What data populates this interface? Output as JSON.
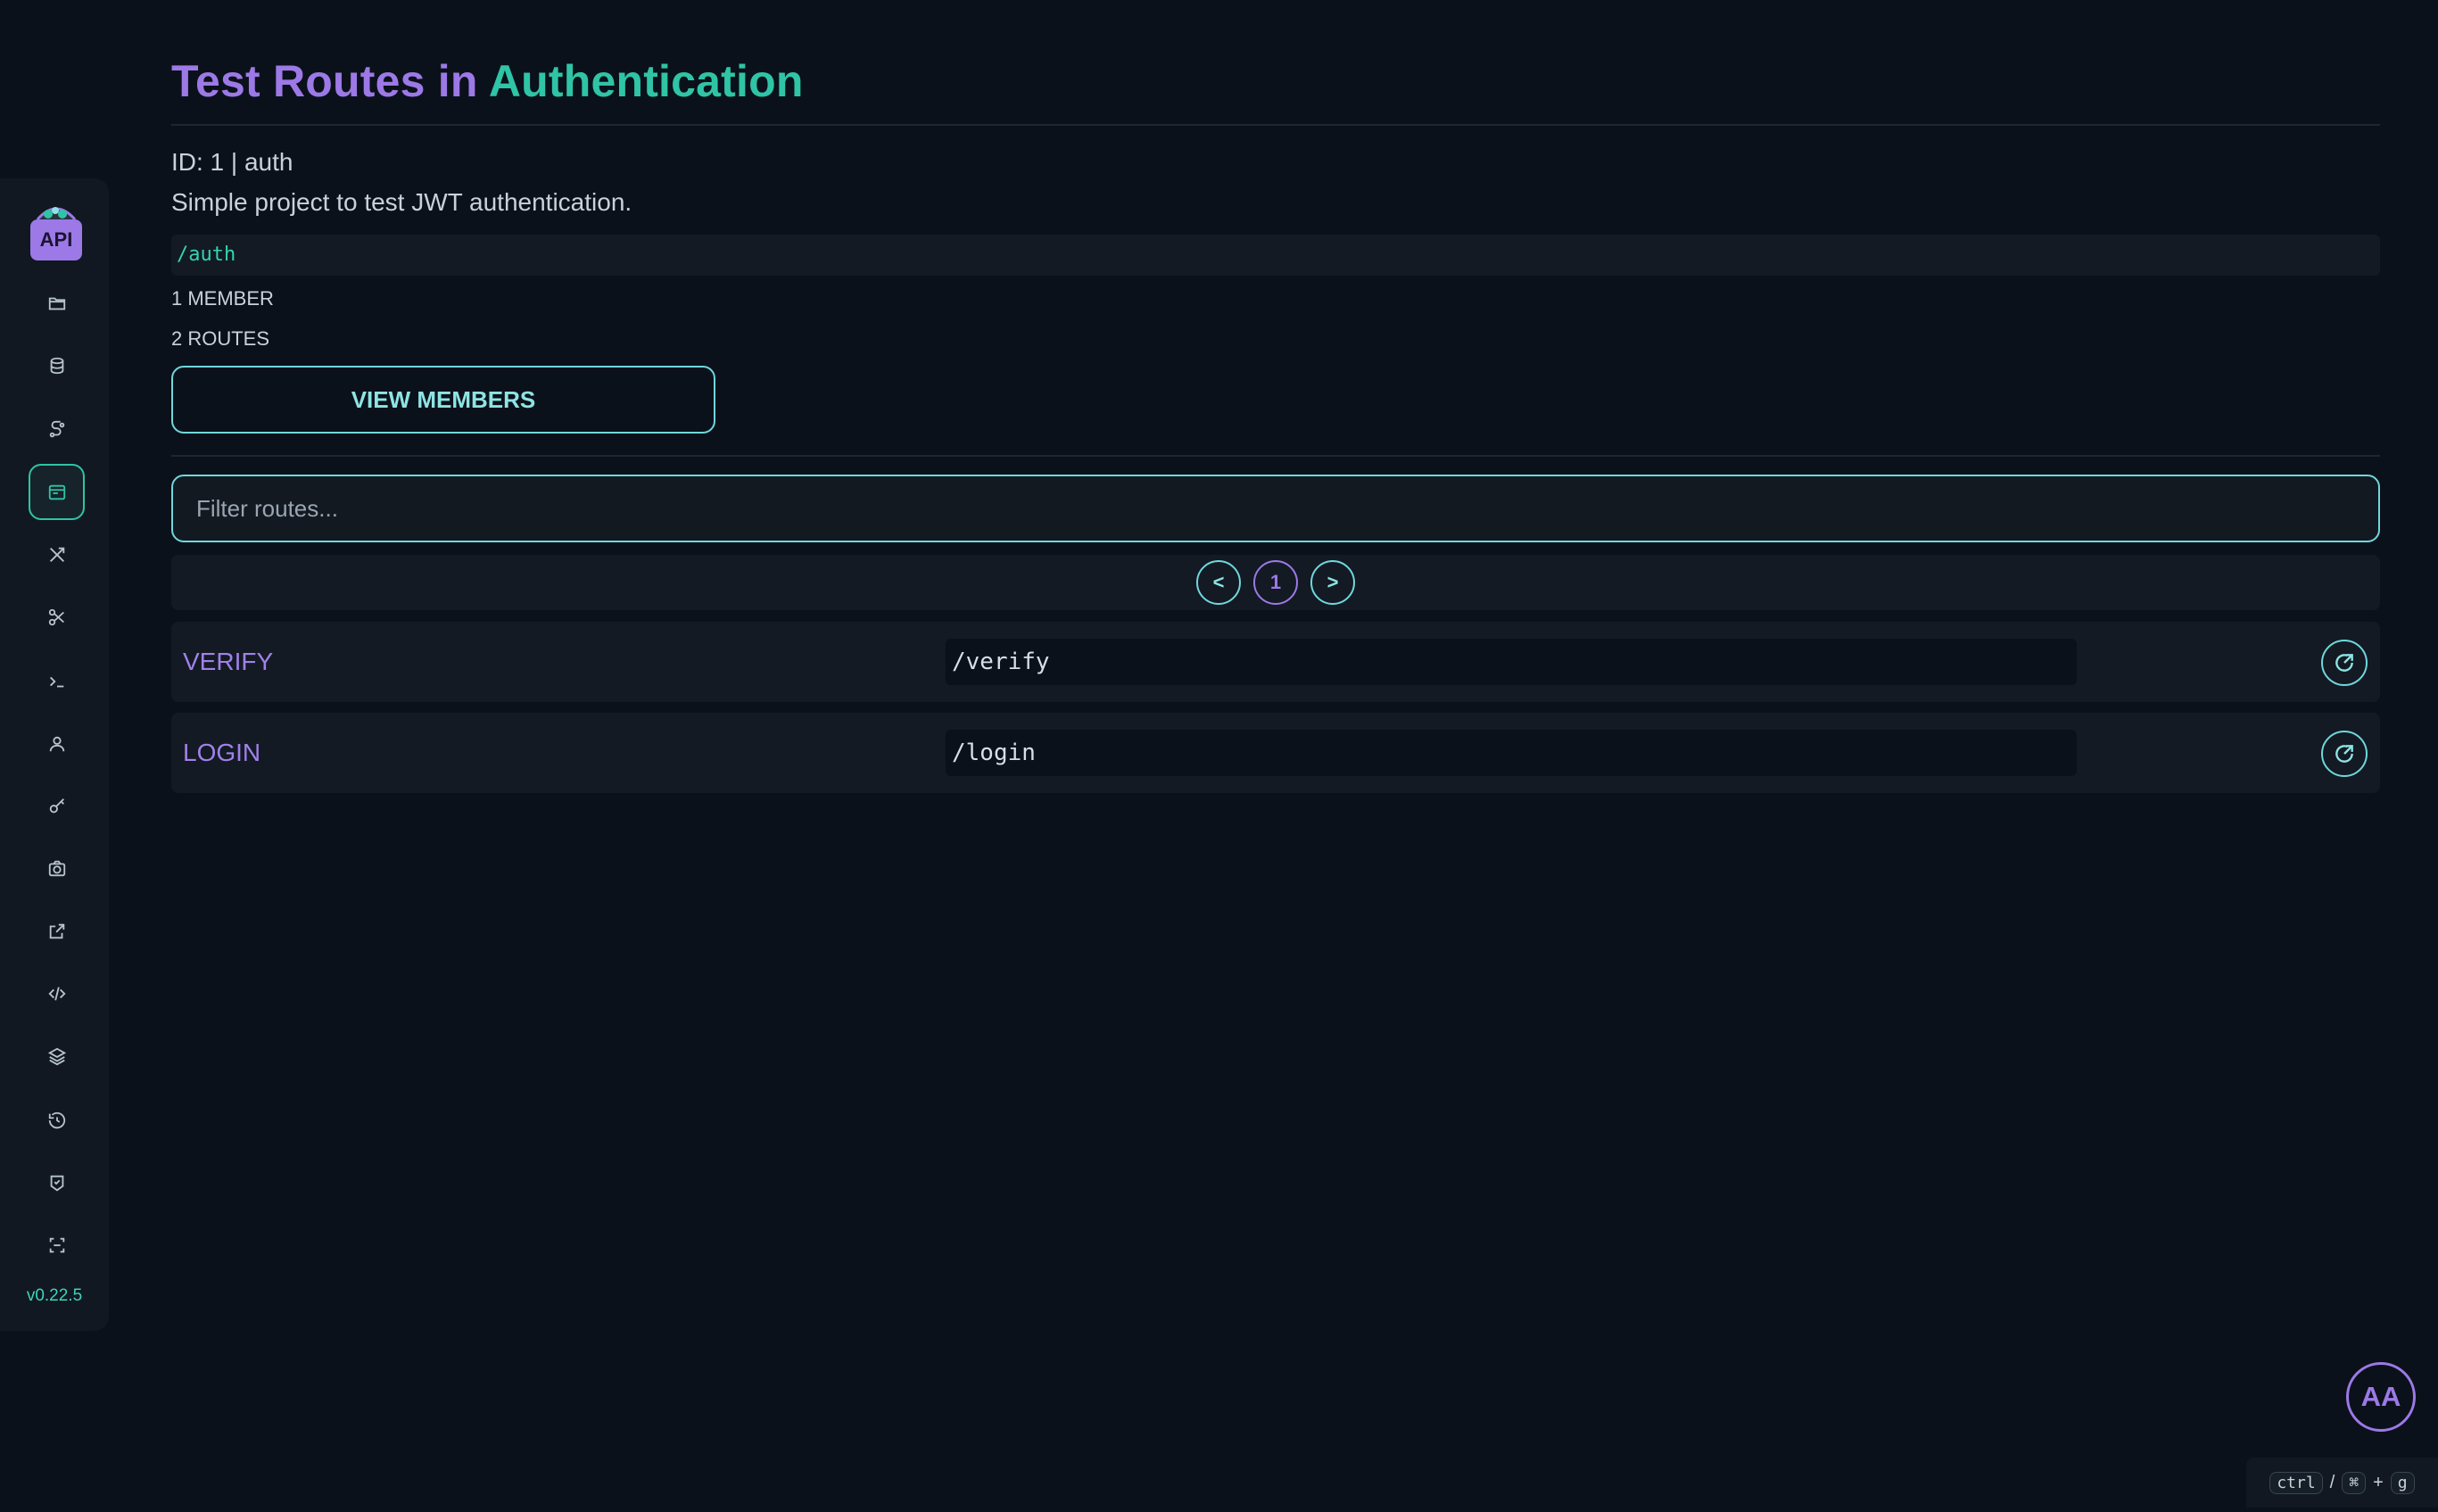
{
  "sidebar": {
    "logo_text": "API",
    "version": "v0.22.5",
    "items": [
      {
        "icon": "folder-icon",
        "active": false
      },
      {
        "icon": "database-icon",
        "active": false
      },
      {
        "icon": "route-icon",
        "active": false
      },
      {
        "icon": "window-icon",
        "active": true
      },
      {
        "icon": "tools-icon",
        "active": false
      },
      {
        "icon": "scissors-icon",
        "active": false
      },
      {
        "icon": "terminal-icon",
        "active": false
      },
      {
        "icon": "user-icon",
        "active": false
      },
      {
        "icon": "key-icon",
        "active": false
      },
      {
        "icon": "camera-icon",
        "active": false
      },
      {
        "icon": "external-link-icon",
        "active": false
      },
      {
        "icon": "code-icon",
        "active": false
      },
      {
        "icon": "layers-icon",
        "active": false
      },
      {
        "icon": "history-icon",
        "active": false
      },
      {
        "icon": "badge-check-icon",
        "active": false
      },
      {
        "icon": "scan-icon",
        "active": false
      }
    ]
  },
  "header": {
    "title_part1": "Test Routes in ",
    "title_part2": "Authentication"
  },
  "project": {
    "id_line": "ID: 1 | auth",
    "description": "Simple project to test JWT authentication.",
    "base_path": "/auth",
    "members": "1 MEMBER",
    "routes": "2 ROUTES",
    "view_members_label": "VIEW MEMBERS"
  },
  "filter": {
    "placeholder": "Filter routes..."
  },
  "pagination": {
    "prev": "<",
    "current": "1",
    "next": ">"
  },
  "routes": [
    {
      "name": "VERIFY",
      "path": "/verify"
    },
    {
      "name": "LOGIN",
      "path": "/login"
    }
  ],
  "user": {
    "initials": "AA"
  },
  "shortcut": {
    "ctrl": "ctrl",
    "sep": "/",
    "cmd": "⌘",
    "plus": "+",
    "key": "g"
  },
  "colors": {
    "accent_purple": "#9c79e6",
    "accent_teal": "#2fc4a6",
    "outline": "#6fd7dc",
    "background": "#0b111a"
  }
}
